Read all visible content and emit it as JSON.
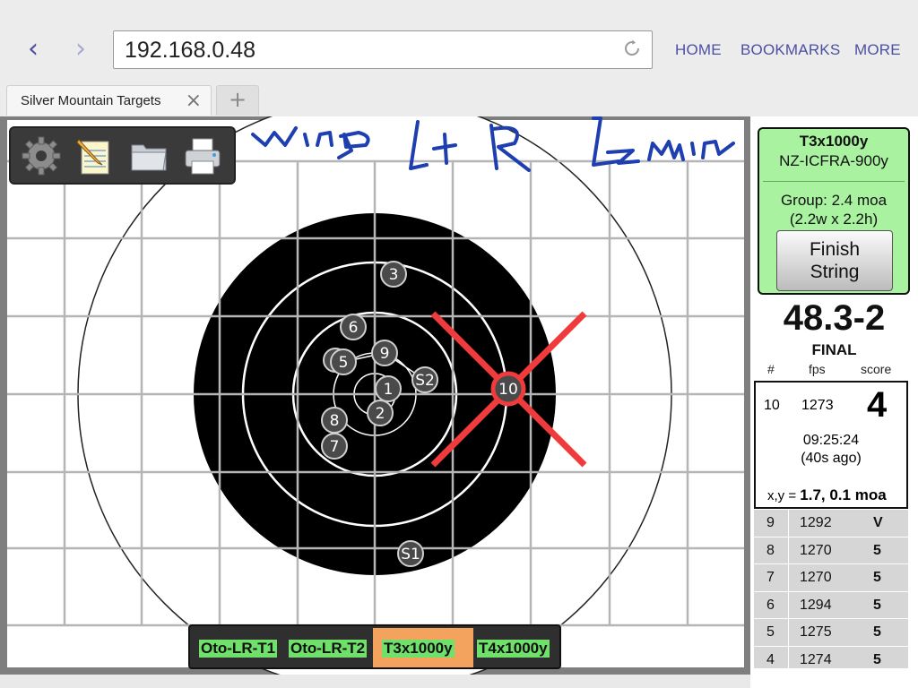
{
  "browser": {
    "url": "192.168.0.48",
    "menu": [
      "HOME",
      "BOOKMARKS",
      "MORE"
    ],
    "tab_title": "Silver Mountain Targets",
    "back_icon": "chevron-left-icon",
    "forward_icon": "chevron-right-icon",
    "reload_icon": "reload-icon",
    "accent_color": "#4b4fa3"
  },
  "toolbar": {
    "tools": [
      "gear-icon",
      "notepad-icon",
      "folder-icon",
      "printer-icon"
    ]
  },
  "target": {
    "shots": [
      {
        "label": "1"
      },
      {
        "label": "2"
      },
      {
        "label": "3"
      },
      {
        "label": "5"
      },
      {
        "label": "6"
      },
      {
        "label": "7"
      },
      {
        "label": "8"
      },
      {
        "label": "9"
      },
      {
        "label": "10"
      },
      {
        "label": "S1"
      },
      {
        "label": "S2"
      }
    ],
    "last_shot": "10",
    "annotation": "handwritten wind note"
  },
  "target_tabs": [
    {
      "label": "Oto-LR-T1",
      "active": false
    },
    {
      "label": "Oto-LR-T2",
      "active": false
    },
    {
      "label": "T3x1000y",
      "active": true
    },
    {
      "label": "T4x1000y",
      "active": false
    }
  ],
  "summary": {
    "target_name": "T3x1000y",
    "course": "NZ-ICFRA-900y",
    "group": "Group: 2.4 moa",
    "group_dims": "(2.2w x 2.2h)",
    "finish_label_1": "Finish",
    "finish_label_2": "String",
    "total": "48.3-2",
    "status": "FINAL"
  },
  "columns": [
    "#",
    "fps",
    "score"
  ],
  "current_shot": {
    "num": "10",
    "fps": "1273",
    "score": "4",
    "time": "09:25:24",
    "ago": "(40s ago)",
    "xy_label": "x,y = ",
    "xy_value": "1.7, 0.1 moa"
  },
  "shot_list": [
    {
      "num": "9",
      "fps": "1292",
      "score": "V"
    },
    {
      "num": "8",
      "fps": "1270",
      "score": "5"
    },
    {
      "num": "7",
      "fps": "1270",
      "score": "5"
    },
    {
      "num": "6",
      "fps": "1294",
      "score": "5"
    },
    {
      "num": "5",
      "fps": "1275",
      "score": "5"
    },
    {
      "num": "4",
      "fps": "1274",
      "score": "5"
    }
  ]
}
